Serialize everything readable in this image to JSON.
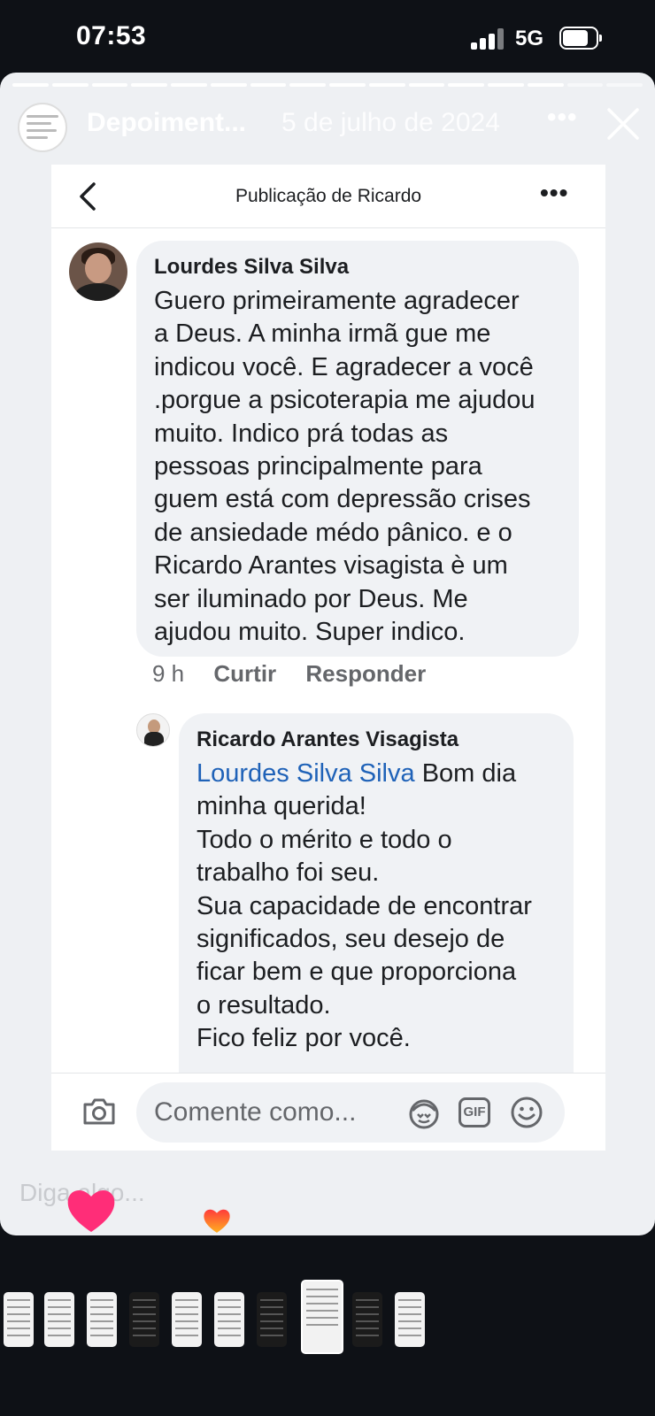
{
  "status_bar": {
    "time": "07:53",
    "network": "5G",
    "battery_level": 0.7
  },
  "story": {
    "title": "Depoiment...",
    "date": "5 de julho de 2024",
    "more_icon": "more-horizontal-icon",
    "close_icon": "close-icon",
    "progress_total": 16,
    "progress_done": 14,
    "reply_placeholder": "Diga algo..."
  },
  "post": {
    "title": "Publicação de Ricardo",
    "back_icon": "chevron-left-icon",
    "more_icon": "more-horizontal-icon"
  },
  "comments": [
    {
      "author": "Lourdes Silva Silva",
      "lines": [
        "Guero primeiramente agradecer",
        "a Deus. A minha irmã gue me",
        "indicou você. E agradecer a você",
        ".porgue a psicoterapia me ajudou",
        "muito. Indico prá todas as",
        "pessoas principalmente para",
        "guem está com depressão crises",
        "de ansiedade médo pânico. e o",
        "Ricardo Arantes visagista è um",
        "ser iluminado por Deus. Me",
        "ajudou muito. Super indico."
      ],
      "time": "9 h",
      "like_label": "Curtir",
      "reply_label": "Responder"
    },
    {
      "author": "Ricardo Arantes Visagista",
      "mention": "Lourdes Silva Silva",
      "first_line_rest": " Bom dia",
      "lines": [
        "minha querida!",
        "Todo o mérito e todo o",
        "trabalho foi seu.",
        "Sua capacidade de encontrar",
        "significados, seu desejo de",
        "ficar bem e que proporciona",
        "o resultado.",
        "Fico feliz por você."
      ]
    }
  ],
  "comment_bar": {
    "placeholder": "Comente como...",
    "gif_label": "GIF",
    "camera_icon": "camera-icon",
    "avatar_sticker_icon": "avatar-sticker-icon",
    "emoji_icon": "emoji-icon"
  },
  "colors": {
    "mention": "#1f62b8",
    "heart_big": "#ff2d78",
    "heart_small": "#ff7a18"
  },
  "thumbnails": {
    "count": 10,
    "selected_index": 7
  }
}
